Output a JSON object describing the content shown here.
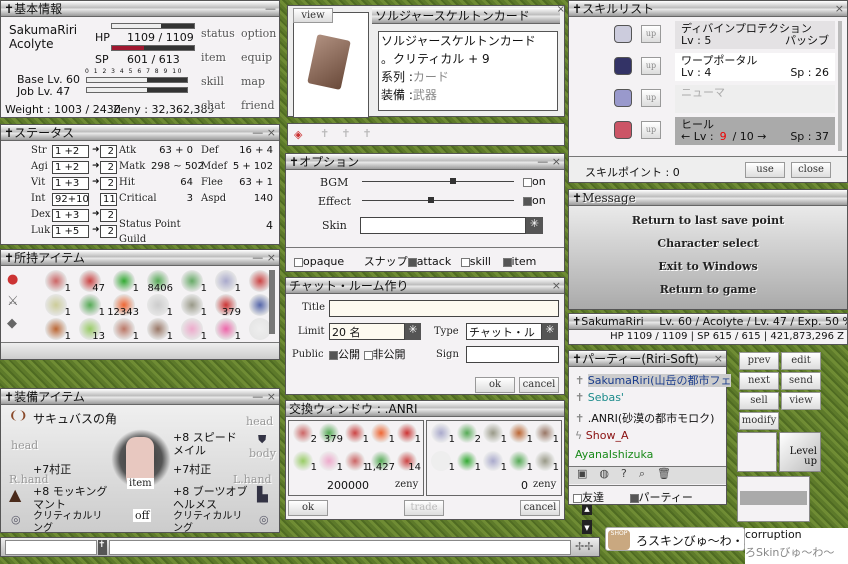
{
  "basic": {
    "title": "基本情報",
    "name": "SakumaRiri",
    "job": "Acolyte",
    "hp_label": "HP",
    "hp": "1109  /  1109",
    "sp_label": "SP",
    "sp": "601  /  613",
    "hp_fraction": 1.0,
    "sp_fraction": 0.98,
    "base_lv": "Base Lv. 60",
    "job_lv": "Job Lv. 47",
    "base_exp_fraction": 0.6,
    "job_exp_fraction": 0.6,
    "scale": "0 1 2 3 4 5 6 7 8 9 10",
    "weight": "Weight : 1003 / 2430",
    "zeny": "Zeny : 32,362,389",
    "menu": [
      "status",
      "option",
      "item",
      "equip",
      "skill",
      "map",
      "chat",
      "friend"
    ]
  },
  "status": {
    "title": "ステータス",
    "stats": [
      {
        "n": "Str",
        "v": "1  +2",
        "r": "2"
      },
      {
        "n": "Agi",
        "v": "1  +2",
        "r": "2"
      },
      {
        "n": "Vit",
        "v": "1  +3",
        "r": "2"
      },
      {
        "n": "Int",
        "v": "92+10",
        "r": "11"
      },
      {
        "n": "Dex",
        "v": "1  +3",
        "r": "2"
      },
      {
        "n": "Luk",
        "v": "1  +5",
        "r": "2"
      }
    ],
    "mid": [
      {
        "n": "Atk",
        "v": "63 + 0"
      },
      {
        "n": "Matk",
        "v": "298 ~ 502"
      },
      {
        "n": "Hit",
        "v": "64"
      },
      {
        "n": "Critical",
        "v": "3"
      }
    ],
    "right": [
      {
        "n": "Def",
        "v": "16 + 4"
      },
      {
        "n": "Mdef",
        "v": "5 + 102"
      },
      {
        "n": "Flee",
        "v": "63 + 1"
      },
      {
        "n": "Aspd",
        "v": "140"
      }
    ],
    "status_point_label": "Status Point",
    "status_point": "4",
    "guild_label": "Guild"
  },
  "inventory": {
    "title": "所持アイテム",
    "counts": [
      "1",
      "47",
      "1",
      "8406",
      "1",
      "1",
      "1",
      "1",
      "1",
      "12343",
      "1",
      "1",
      "379",
      "1",
      "1",
      "13",
      "1",
      "1",
      "1",
      "1",
      ""
    ]
  },
  "equip": {
    "title": "装備アイテム",
    "head_top": "サキュバスの角",
    "head_mid": "head",
    "body": "+8 スピードメイル",
    "r_hand": "+7村正",
    "l_hand": "+7村正",
    "garment": "+8 モッキングマント",
    "shoes": "+8 ブーツオブヘルメス",
    "acc1": "クリティカルリング",
    "acc2": "クリティカルリング",
    "item_btn": "item",
    "off_btn": "off",
    "labels": {
      "head": "head",
      "body": "body",
      "rhand": "R.hand",
      "lhand": "L.hand",
      "robe": "robe",
      "shoes": "shoes",
      "acc1": "accessory",
      "acc2": "accessory"
    }
  },
  "card": {
    "view": "view",
    "title": "ソルジャースケルトンカード",
    "lines": [
      "ソルジャースケルトンカード",
      "。クリティカル + 9"
    ],
    "type_label": "系列 :",
    "type": "カード",
    "equip_label": "装備 :",
    "equip": "武器"
  },
  "option": {
    "title": "オプション",
    "bgm": "BGM",
    "effect": "Effect",
    "skin": "Skin",
    "bgm_level": 0.6,
    "effect_level": 0.45,
    "bgm_on": false,
    "effect_on": true,
    "on": "on",
    "opaque": "opaque",
    "snap": "スナップ",
    "attack": "attack",
    "skill": "skill",
    "item": "item"
  },
  "chatroom": {
    "title": "チャット・ルーム作り",
    "title_label": "Title",
    "limit_label": "Limit",
    "limit": "20 名",
    "type_label": "Type",
    "type": "チャット・ルー",
    "public_label": "Public",
    "public": "公開",
    "private": "非公開",
    "sign_label": "Sign",
    "ok": "ok",
    "cancel": "cancel"
  },
  "trade": {
    "title": "交換ウィンドウ : .ANRI",
    "left_counts": [
      "2",
      "379",
      "1",
      "1",
      "1",
      "1",
      "1",
      "1",
      "1,427",
      "14"
    ],
    "right_counts": [
      "1",
      "2",
      "1",
      "1",
      "1",
      "1",
      "1",
      "1",
      "1",
      "1"
    ],
    "left_zeny": "200000",
    "right_zeny": "0",
    "zeny": "zeny",
    "ok": "ok",
    "trade": "trade",
    "cancel": "cancel"
  },
  "skills": {
    "title": "スキルリスト",
    "up": "up",
    "list": [
      {
        "name": "ディバインプロテクション",
        "lv": "Lv : 5",
        "extra": "パッシブ"
      },
      {
        "name": "ワープポータル",
        "lv": "Lv : 4",
        "extra": "Sp : 26"
      },
      {
        "name": "ニューマ",
        "lv": "",
        "extra": ""
      },
      {
        "name": "ヒール",
        "lv": "← Lv :",
        "cur": "9",
        "max": "/ 10 →",
        "extra": "Sp : 37"
      }
    ],
    "points": "スキルポイント : 0",
    "use": "use",
    "close": "close"
  },
  "message": {
    "title": "Message",
    "options": [
      "Return to last save point",
      "Character select",
      "Exit to Windows",
      "Return to game"
    ]
  },
  "statusbar": {
    "name": "SakumaRiri",
    "info": "Lv. 60 / Acolyte / Lv. 47 / Exp. 50 %",
    "stats": "HP  1109 / 1109  |  SP  615 / 615  |  421,873,296 Z"
  },
  "party": {
    "title": "パーティー(Riri-Soft)",
    "members": [
      {
        "name": "SakumaRiri(山岳の都市フェ",
        "color": "#1a3c8c"
      },
      {
        "name": "Sebas'",
        "color": "#1a8a8a"
      },
      {
        "name": ".ANRI(砂漠の都市モロク)",
        "color": "#111111"
      },
      {
        "name": "Show_A",
        "color": "#8a1010"
      },
      {
        "name": "AyanaIshizuka",
        "color": "#1a8a1a"
      }
    ],
    "friends": "友達",
    "party_tab": "パーティー"
  },
  "side_buttons": [
    "prev",
    "edit",
    "next",
    "send",
    "sell",
    "view",
    "modify"
  ],
  "levelup": "Level up",
  "shop": {
    "badge": "SHOP",
    "text": "ろスキンびゅ〜わ・.."
  },
  "corruption": {
    "line1": "corruption",
    "line2": "ろSkinびゅ〜わ〜"
  }
}
